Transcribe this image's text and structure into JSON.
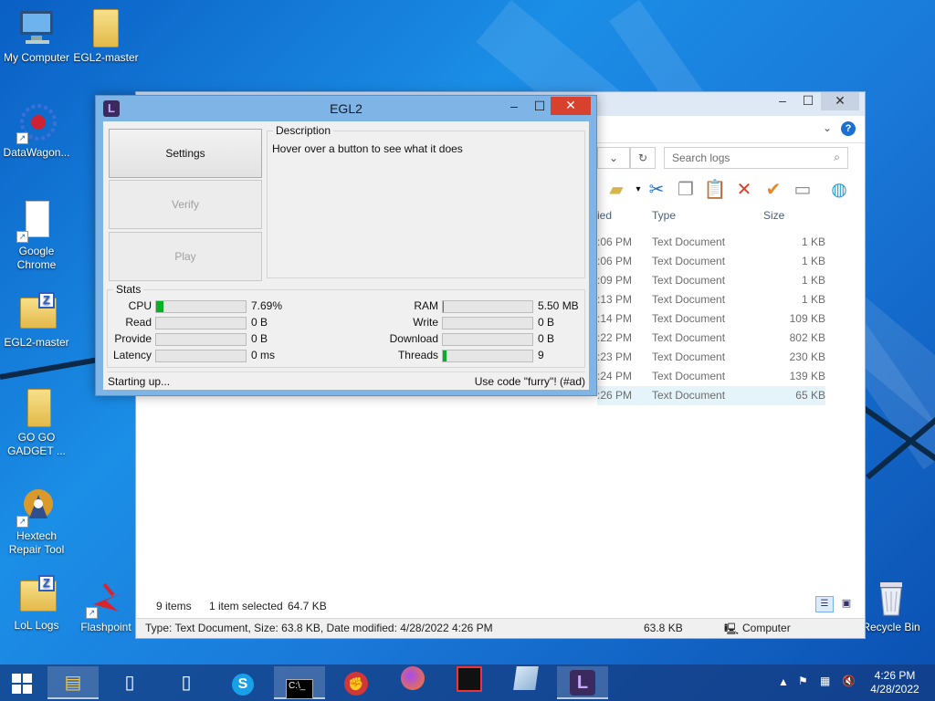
{
  "desktop": {
    "icons": [
      {
        "label": "My Computer",
        "icon": "computer-icon"
      },
      {
        "label": "EGL2-master",
        "icon": "folder-icon"
      },
      {
        "label": "DataWagon...",
        "icon": "datawagon-icon"
      },
      {
        "label": "Google Chrome",
        "icon": "blank-file-icon"
      },
      {
        "label": "EGL2-master",
        "icon": "zip-folder-icon"
      },
      {
        "label": "GO GO GADGET ...",
        "icon": "folder-icon"
      },
      {
        "label": "Hextech Repair Tool",
        "icon": "hextech-icon"
      },
      {
        "label": "LoL Logs",
        "icon": "zip-folder-icon"
      },
      {
        "label": "Flashpoint",
        "icon": "flashpoint-icon"
      },
      {
        "label": "Recycle Bin",
        "icon": "recycle-bin-icon"
      }
    ]
  },
  "explorer": {
    "search_placeholder": "Search logs",
    "columns": {
      "modified": "ied",
      "type": "Type",
      "size": "Size"
    },
    "rows": [
      {
        "time": ":06 PM",
        "type": "Text Document",
        "size": "1 KB"
      },
      {
        "time": ":06 PM",
        "type": "Text Document",
        "size": "1 KB"
      },
      {
        "time": ":09 PM",
        "type": "Text Document",
        "size": "1 KB"
      },
      {
        "time": ":13 PM",
        "type": "Text Document",
        "size": "1 KB"
      },
      {
        "time": ":14 PM",
        "type": "Text Document",
        "size": "109 KB"
      },
      {
        "time": ":22 PM",
        "type": "Text Document",
        "size": "802 KB"
      },
      {
        "time": ":23 PM",
        "type": "Text Document",
        "size": "230 KB"
      },
      {
        "time": ":24 PM",
        "type": "Text Document",
        "size": "139 KB"
      },
      {
        "time": ":26 PM",
        "type": "Text Document",
        "size": "65 KB"
      }
    ],
    "footer": {
      "items": "9 items",
      "selected": "1 item selected",
      "selected_size": "64.7 KB"
    },
    "statusbar": {
      "details": "Type: Text Document, Size: 63.8 KB, Date modified: 4/28/2022 4:26 PM",
      "size": "63.8 KB",
      "location": "Computer"
    }
  },
  "egl": {
    "title": "EGL2",
    "logo_letter": "L",
    "buttons": {
      "settings": "Settings",
      "verify": "Verify",
      "play": "Play"
    },
    "description": {
      "legend": "Description",
      "text": "Hover over a button to see what it does"
    },
    "stats": {
      "legend": "Stats",
      "cpu": {
        "label": "CPU",
        "value": "7.69%",
        "fill": 0.077
      },
      "read": {
        "label": "Read",
        "value": "0 B",
        "fill": 0
      },
      "provide": {
        "label": "Provide",
        "value": "0 B",
        "fill": 0
      },
      "latency": {
        "label": "Latency",
        "value": "0 ms",
        "fill": 0
      },
      "ram": {
        "label": "RAM",
        "value": "5.50 MB",
        "fill": 0.01
      },
      "write": {
        "label": "Write",
        "value": "0 B",
        "fill": 0
      },
      "download": {
        "label": "Download",
        "value": "0 B",
        "fill": 0
      },
      "threads": {
        "label": "Threads",
        "value": "9",
        "fill": 0.04
      }
    },
    "status_left": "Starting up...",
    "status_right": "Use code \"furry\"! (#ad)"
  },
  "taskbar": {
    "clock_time": "4:26 PM",
    "clock_date": "4/28/2022"
  },
  "colors": {
    "accent": "#1b8ee6",
    "progress": "#06b025",
    "close": "#d9412f"
  }
}
